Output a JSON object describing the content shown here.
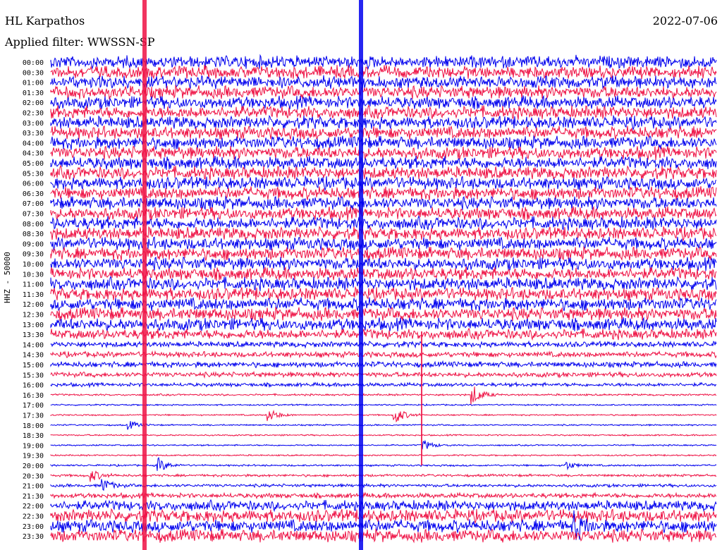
{
  "header": {
    "station": "HL Karpathos",
    "date": "2022-07-06",
    "filter": "Applied filter: WWSSN-SP"
  },
  "y_axis_label": "HHZ - 50000",
  "colors": {
    "odd_trace": "#0000ee",
    "even_trace": "#ee1144"
  },
  "chart_data": {
    "type": "line",
    "title": "HL Karpathos",
    "subtitle": "Applied filter: WWSSN-SP",
    "date": "2022-07-06",
    "channel": "HHZ",
    "ylabel": "HHZ - 50000",
    "categories": [
      "00:00",
      "00:30",
      "01:00",
      "01:30",
      "02:00",
      "02:30",
      "03:00",
      "03:30",
      "04:00",
      "04:30",
      "05:00",
      "05:30",
      "06:00",
      "06:30",
      "07:00",
      "07:30",
      "08:00",
      "08:30",
      "09:00",
      "09:30",
      "10:00",
      "10:30",
      "11:00",
      "11:30",
      "12:00",
      "12:30",
      "13:00",
      "13:30",
      "14:00",
      "14:30",
      "15:00",
      "15:30",
      "16:00",
      "16:30",
      "17:00",
      "17:30",
      "18:00",
      "18:30",
      "19:00",
      "19:30",
      "20:00",
      "20:30",
      "21:00",
      "21:30",
      "22:00",
      "22:30",
      "23:00",
      "23:30"
    ],
    "relative_noise_amplitude": [
      1.0,
      1.0,
      1.0,
      1.0,
      1.0,
      1.0,
      1.0,
      1.0,
      1.0,
      1.0,
      1.0,
      1.0,
      1.0,
      1.0,
      1.0,
      1.0,
      1.0,
      1.0,
      1.0,
      1.0,
      1.0,
      1.0,
      1.0,
      1.0,
      1.0,
      1.0,
      1.0,
      0.8,
      0.45,
      0.45,
      0.45,
      0.4,
      0.3,
      0.15,
      0.12,
      0.12,
      0.12,
      0.12,
      0.12,
      0.12,
      0.15,
      0.2,
      0.25,
      0.4,
      0.8,
      1.0,
      1.0,
      1.0
    ],
    "events": [
      {
        "row": 33,
        "minute_offset": 19.0,
        "amplitude": 1.8
      },
      {
        "row": 35,
        "minute_offset": 9.8,
        "amplitude": 1.2
      },
      {
        "row": 35,
        "minute_offset": 15.5,
        "amplitude": 1.6
      },
      {
        "row": 36,
        "minute_offset": 3.5,
        "amplitude": 0.8
      },
      {
        "row": 38,
        "minute_offset": 16.8,
        "amplitude": 0.9
      },
      {
        "row": 40,
        "minute_offset": 4.8,
        "amplitude": 1.4
      },
      {
        "row": 40,
        "minute_offset": 23.2,
        "amplitude": 0.8
      },
      {
        "row": 41,
        "minute_offset": 1.8,
        "amplitude": 1.1
      },
      {
        "row": 42,
        "minute_offset": 2.3,
        "amplitude": 1.3
      },
      {
        "row": 46,
        "minute_offset": 23.6,
        "amplitude": 2.2
      }
    ],
    "grid": false,
    "legend": "none"
  }
}
